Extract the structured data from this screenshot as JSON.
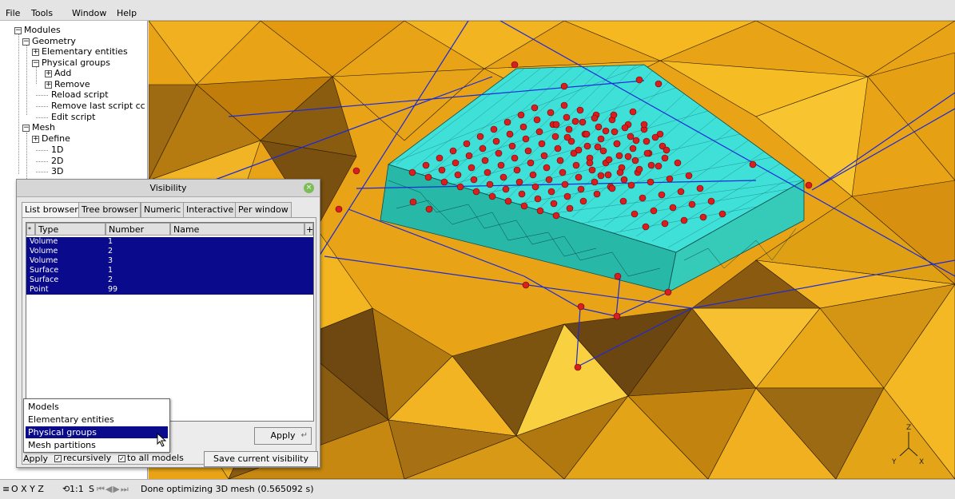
{
  "menu": {
    "file": "File",
    "tools": "Tools",
    "window": "Window",
    "help": "Help"
  },
  "tree": {
    "modules": "Modules",
    "geometry": "Geometry",
    "elementary_entities": "Elementary entities",
    "physical_groups": "Physical groups",
    "add": "Add",
    "remove": "Remove",
    "reload_script": "Reload script",
    "remove_last_script": "Remove last script cc",
    "edit_script": "Edit script",
    "mesh": "Mesh",
    "define": "Define",
    "mesh_1d": "1D",
    "mesh_2d": "2D",
    "mesh_3d": "3D"
  },
  "visibility": {
    "title": "Visibility",
    "tabs": [
      "List browser",
      "Tree browser",
      "Numeric",
      "Interactive",
      "Per window"
    ],
    "columns": {
      "sort": "*",
      "type": "Type",
      "number": "Number",
      "name": "Name",
      "plus": "+"
    },
    "rows": [
      {
        "type": "Volume",
        "number": "1",
        "name": ""
      },
      {
        "type": "Volume",
        "number": "2",
        "name": ""
      },
      {
        "type": "Volume",
        "number": "3",
        "name": ""
      },
      {
        "type": "Surface",
        "number": "1",
        "name": ""
      },
      {
        "type": "Surface",
        "number": "2",
        "name": ""
      },
      {
        "type": "Point",
        "number": "99",
        "name": ""
      }
    ],
    "apply_button": "Apply",
    "bottom": {
      "apply": "Apply",
      "recursively": "recursively",
      "to_all_models": "to all models",
      "save_button": "Save current visibility"
    }
  },
  "dropdown": {
    "options": [
      "Models",
      "Elementary entities",
      "Physical groups",
      "Mesh partitions"
    ],
    "selected": "Physical groups"
  },
  "status": {
    "icons": "≡",
    "axes": "O X Y Z",
    "scale": "1:1",
    "s": "S",
    "message": "Done optimizing 3D mesh (0.565092 s)"
  },
  "axes_gizmo": {
    "x": "X",
    "y": "Y",
    "z": "Z"
  },
  "colors": {
    "mesh_orange": "#e6a014",
    "mesh_cyan": "#3fe0d8",
    "points": "#d81e1e",
    "geometry_lines": "#1a2ad8",
    "selection": "#0a0a8c"
  },
  "icon_names": [
    "expand-box-icon",
    "collapse-box-icon",
    "close-icon",
    "checkbox-icon",
    "cursor-icon",
    "play-icons"
  ]
}
